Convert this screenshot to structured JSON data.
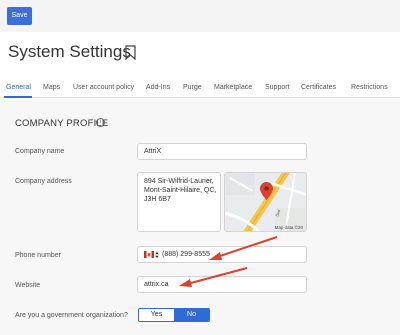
{
  "toolbar": {
    "save_label": "Save"
  },
  "page": {
    "title": "System Settings"
  },
  "tabs": [
    {
      "label": "General",
      "active": true
    },
    {
      "label": "Maps"
    },
    {
      "label": "User account policy"
    },
    {
      "label": "Add-Ins"
    },
    {
      "label": "Purge"
    },
    {
      "label": "Marketplace"
    },
    {
      "label": "Support"
    },
    {
      "label": "Certificates"
    },
    {
      "label": "Restrictions"
    }
  ],
  "section": {
    "title": "COMPANY PROFILE",
    "info_icon": "info-circle-icon"
  },
  "fields": {
    "company_name": {
      "label": "Company name",
      "value": "AttriX"
    },
    "company_address": {
      "label": "Company address",
      "lines": [
        "894 Sir-Wilfrid-Laurier,",
        "Mont-Saint-Hilaire, QC,",
        "J3H 6B7"
      ]
    },
    "map": {
      "attribution": "Map data ©20"
    },
    "phone": {
      "label": "Phone number",
      "value": "(888) 299-8555",
      "flag_icon": "canada-flag-icon"
    },
    "website": {
      "label": "Website",
      "value": "attrix.ca"
    },
    "government": {
      "label": "Are you a government organization?",
      "yes": "Yes",
      "no": "No",
      "selected": "No"
    }
  },
  "colors": {
    "accent": "#2f6bd8",
    "arrow": "#d9432f",
    "map_pin": "#d9432f"
  }
}
